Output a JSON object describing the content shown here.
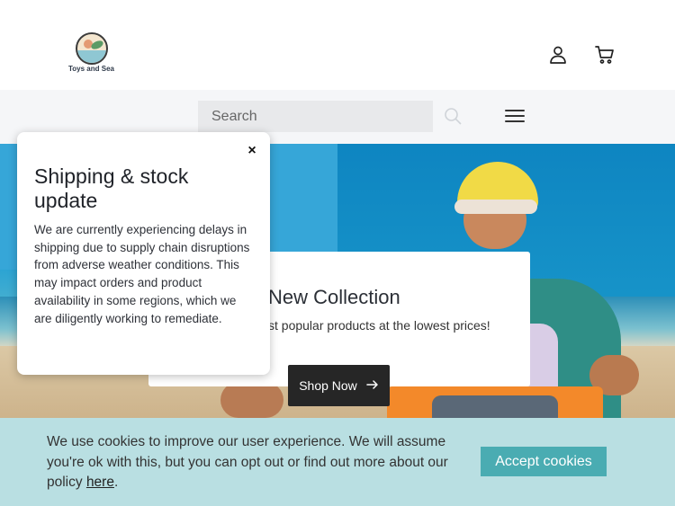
{
  "header": {
    "logo_text": "Toys and Sea",
    "account_icon": "user-icon",
    "cart_icon": "cart-icon"
  },
  "search": {
    "placeholder": "Search",
    "search_icon": "search-icon",
    "menu_icon": "hamburger-menu-icon"
  },
  "hero": {
    "title": "New Collection",
    "subtitle": "st popular products at the lowest prices!",
    "button_label": "Shop Now",
    "button_icon": "arrow-right-icon"
  },
  "modal": {
    "close_label": "×",
    "title": "Shipping & stock update",
    "body": "We are currently experiencing delays in shipping due to supply chain disruptions from adverse weather conditions. This may impact orders and product availability in some regions, which we are diligently working to remediate."
  },
  "cookie": {
    "text_before_link": "We use cookies to improve our user experience. We will assume you're ok with this, but you can opt out or find out more about our policy ",
    "link_text": "here",
    "text_after_link": ".",
    "accept_label": "Accept cookies"
  },
  "colors": {
    "cookie_bg": "#b9dfe2",
    "cookie_button": "#4aacb2",
    "shop_button": "#262626",
    "search_bg": "#e8e9eb"
  }
}
